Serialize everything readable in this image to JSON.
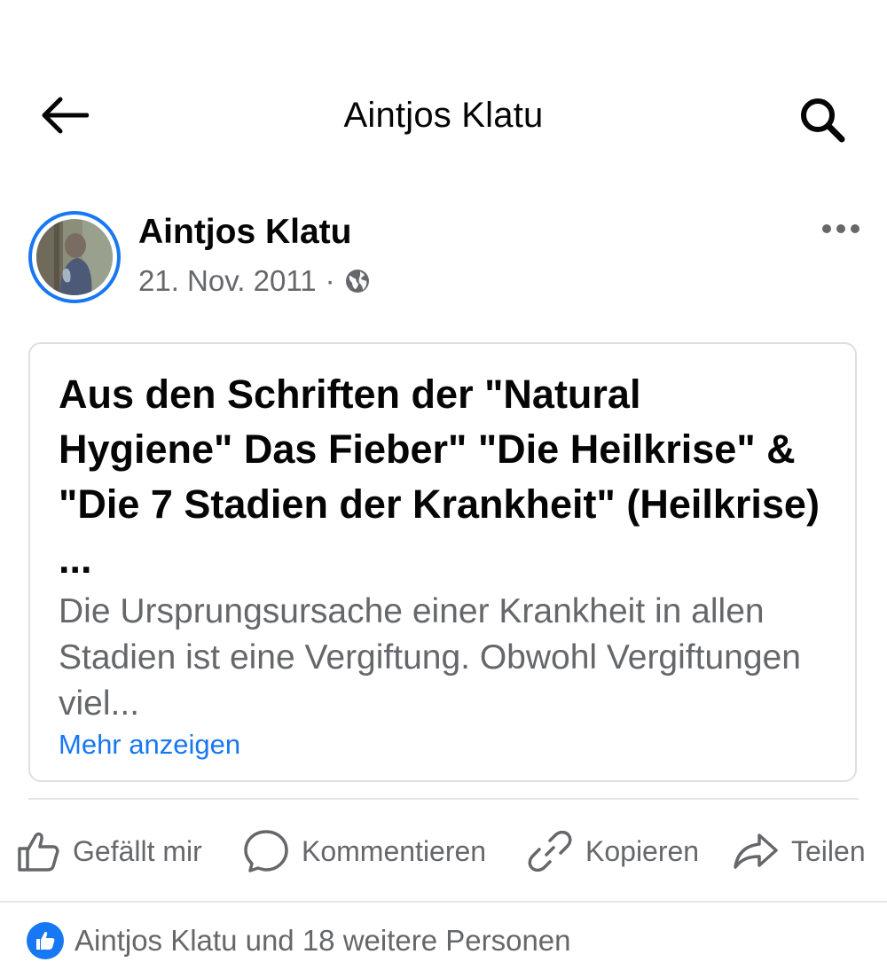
{
  "topbar": {
    "title": "Aintjos Klatu",
    "back_icon": "arrow-left-icon",
    "search_icon": "search-icon"
  },
  "post": {
    "author": "Aintjos Klatu",
    "date": "21. Nov. 2011",
    "separator": "·",
    "privacy_icon": "globe-icon",
    "more_icon": "more-dots-icon"
  },
  "card": {
    "title": "Aus den Schriften der \"Natural Hygiene\" Das Fieber\" \"Die Heilkrise\" & \"Die 7 Stadien der Krankheit\" (Heilkrise) ...",
    "body": "Die Ursprungsursache einer Krankheit in allen Stadien ist eine  Vergiftung. Obwohl Vergiftungen viel...",
    "more_label": "Mehr anzeigen"
  },
  "actions": [
    {
      "label": "Gefällt mir",
      "icon": "thumbs-up-icon"
    },
    {
      "label": "Kommentieren",
      "icon": "comment-icon"
    },
    {
      "label": "Kopieren",
      "icon": "link-icon"
    },
    {
      "label": "Teilen",
      "icon": "share-icon"
    }
  ],
  "reactions": {
    "text": "Aintjos Klatu und 18 weitere Personen",
    "icon": "like-badge-icon"
  },
  "colors": {
    "accent": "#1877f2",
    "secondary_text": "#65676b",
    "divider": "#e4e6eb"
  }
}
